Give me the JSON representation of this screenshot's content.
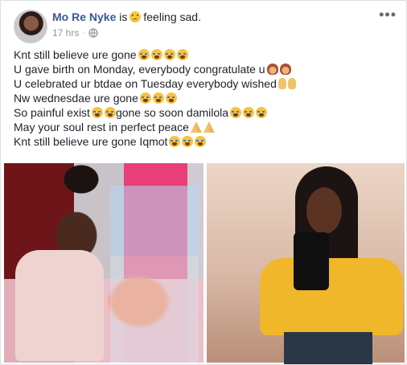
{
  "post": {
    "author": "Mo Re Nyke",
    "is_text": "is",
    "feeling_text": "feeling sad.",
    "timestamp": "17 hrs",
    "separator": "·",
    "more_label": "•••",
    "lines": [
      {
        "text": "Knt still believe ure gone",
        "emoji": [
          "cry",
          "cry",
          "cry",
          "cry"
        ]
      },
      {
        "text": "U gave birth on Monday, everybody congratulate u",
        "emoji": [
          "lady",
          "lady"
        ]
      },
      {
        "text": "U celebrated ur btdae on Tuesday everybody wished",
        "emoji": [
          "hand",
          "hand"
        ]
      },
      {
        "text": "Nw wednesdae ure gone",
        "emoji": [
          "cry",
          "cry",
          "cry"
        ]
      },
      {
        "text": "So painful exist",
        "emoji": [
          "cry",
          "cry"
        ],
        "tail": "gone so soon damilola",
        "tail_emoji": [
          "cry",
          "cry",
          "cry"
        ]
      },
      {
        "text": "May your soul rest in perfect peace",
        "emoji": [
          "pray",
          "pray"
        ]
      },
      {
        "text": "Knt still believe ure gone Iqmot",
        "emoji": [
          "cry",
          "cry",
          "cry"
        ]
      }
    ]
  },
  "colors": {
    "author": "#385898",
    "text": "#1d2129",
    "meta": "#90949c",
    "background": "#e9ebee"
  }
}
